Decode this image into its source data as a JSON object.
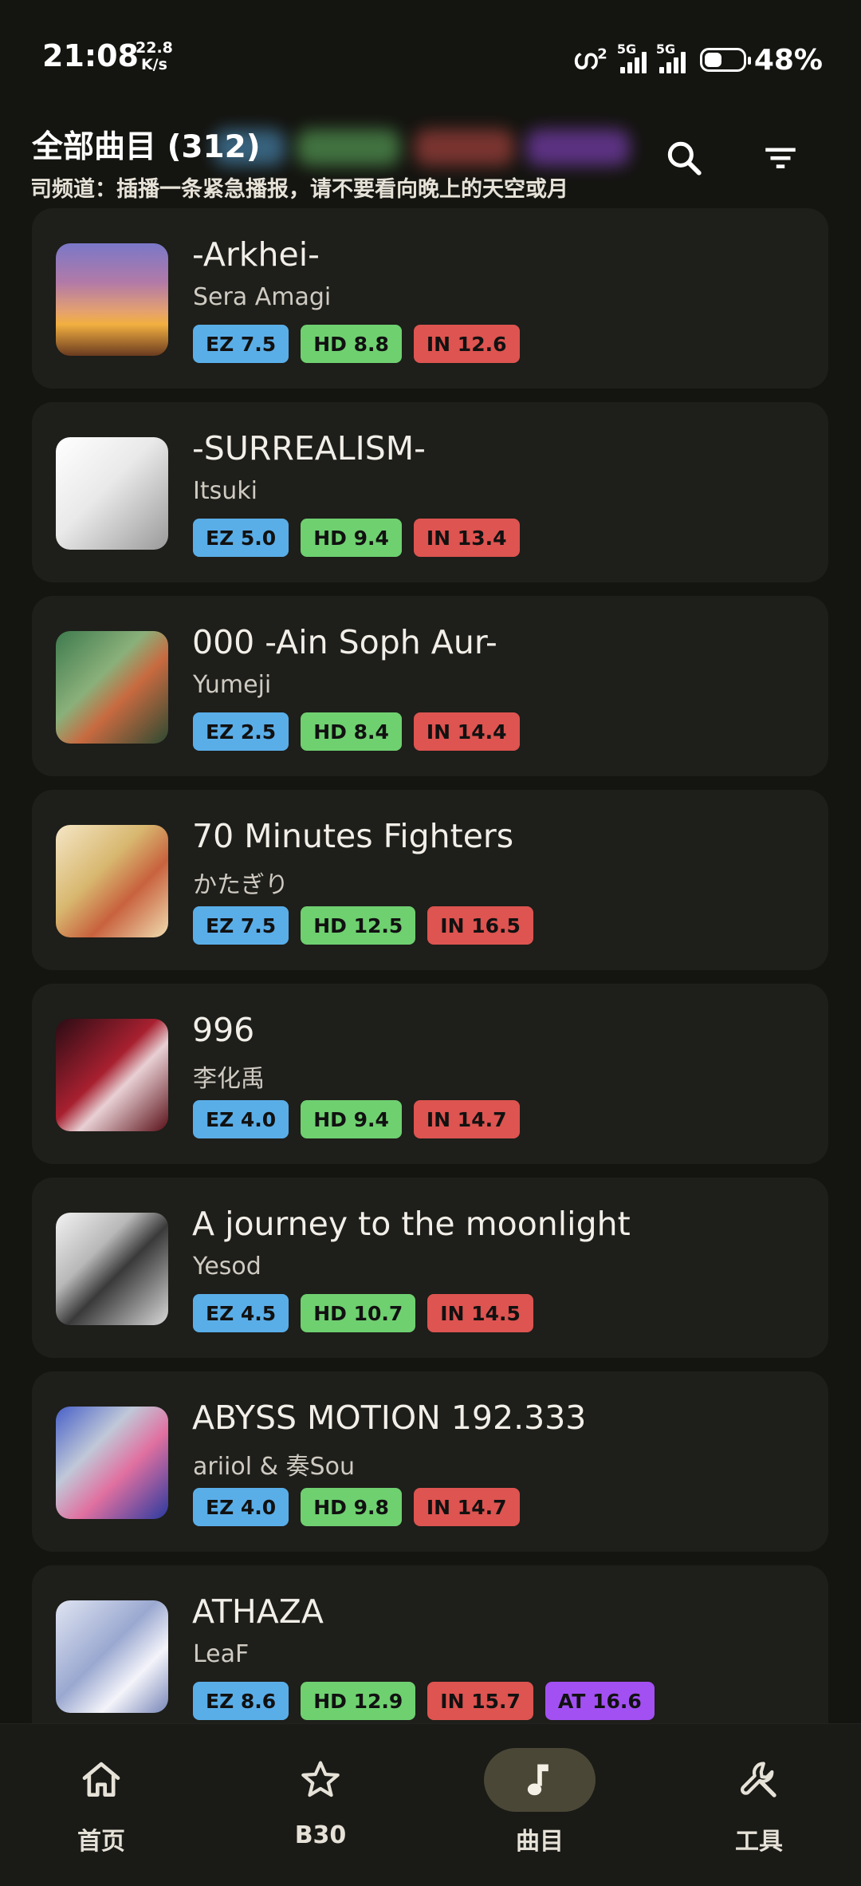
{
  "status_bar": {
    "time": "21:08",
    "net_speed_value": "22.8",
    "net_speed_unit": "K/s",
    "hotspot_count": "2",
    "sim1_label": "5G",
    "sim2_label": "5G",
    "battery_percent": "48%"
  },
  "header": {
    "title": "全部曲目 (312)",
    "marquee": "司频道：插播一条紧急播报，请不要看向晚上的天空或月",
    "search_icon": "search-icon",
    "filter_icon": "filter-icon"
  },
  "colors": {
    "background": "#141410",
    "card": "#1e1e1a",
    "ez": "#5aaee8",
    "hd": "#6fd070",
    "in": "#dd5450",
    "at": "#a250f2",
    "nav_active": "#4a4736"
  },
  "songs": [
    {
      "title": "-Arkhei-",
      "artist": "Sera Amagi",
      "charts": [
        {
          "label": "EZ 7.5",
          "kind": "ez"
        },
        {
          "label": "HD 8.8",
          "kind": "hd"
        },
        {
          "label": "IN 12.6",
          "kind": "in"
        }
      ]
    },
    {
      "title": "-SURREALISM-",
      "artist": "Itsuki",
      "charts": [
        {
          "label": "EZ 5.0",
          "kind": "ez"
        },
        {
          "label": "HD 9.4",
          "kind": "hd"
        },
        {
          "label": "IN 13.4",
          "kind": "in"
        }
      ]
    },
    {
      "title": "000 -Ain Soph Aur-",
      "artist": "Yumeji",
      "charts": [
        {
          "label": "EZ 2.5",
          "kind": "ez"
        },
        {
          "label": "HD 8.4",
          "kind": "hd"
        },
        {
          "label": "IN 14.4",
          "kind": "in"
        }
      ]
    },
    {
      "title": "70 Minutes Fighters",
      "artist": "かたぎり",
      "charts": [
        {
          "label": "EZ 7.5",
          "kind": "ez"
        },
        {
          "label": "HD 12.5",
          "kind": "hd"
        },
        {
          "label": "IN 16.5",
          "kind": "in"
        }
      ]
    },
    {
      "title": "996",
      "artist": "李化禹",
      "charts": [
        {
          "label": "EZ 4.0",
          "kind": "ez"
        },
        {
          "label": "HD 9.4",
          "kind": "hd"
        },
        {
          "label": "IN 14.7",
          "kind": "in"
        }
      ]
    },
    {
      "title": "A journey to the moonlight",
      "artist": "Yesod",
      "charts": [
        {
          "label": "EZ 4.5",
          "kind": "ez"
        },
        {
          "label": "HD 10.7",
          "kind": "hd"
        },
        {
          "label": "IN 14.5",
          "kind": "in"
        }
      ]
    },
    {
      "title": "ABYSS MOTION 192.333",
      "artist": "ariiol & 奏Sou",
      "charts": [
        {
          "label": "EZ 4.0",
          "kind": "ez"
        },
        {
          "label": "HD 9.8",
          "kind": "hd"
        },
        {
          "label": "IN 14.7",
          "kind": "in"
        }
      ]
    },
    {
      "title": "ATHAZA",
      "artist": "LeaF",
      "charts": [
        {
          "label": "EZ 8.6",
          "kind": "ez"
        },
        {
          "label": "HD 12.9",
          "kind": "hd"
        },
        {
          "label": "IN 15.7",
          "kind": "in"
        },
        {
          "label": "AT 16.6",
          "kind": "at"
        }
      ]
    }
  ],
  "nav": [
    {
      "label": "首页",
      "icon": "home-icon",
      "active": false
    },
    {
      "label": "B30",
      "icon": "star-icon",
      "active": false
    },
    {
      "label": "曲目",
      "icon": "music-note-icon",
      "active": true
    },
    {
      "label": "工具",
      "icon": "wrench-icon",
      "active": false
    }
  ]
}
